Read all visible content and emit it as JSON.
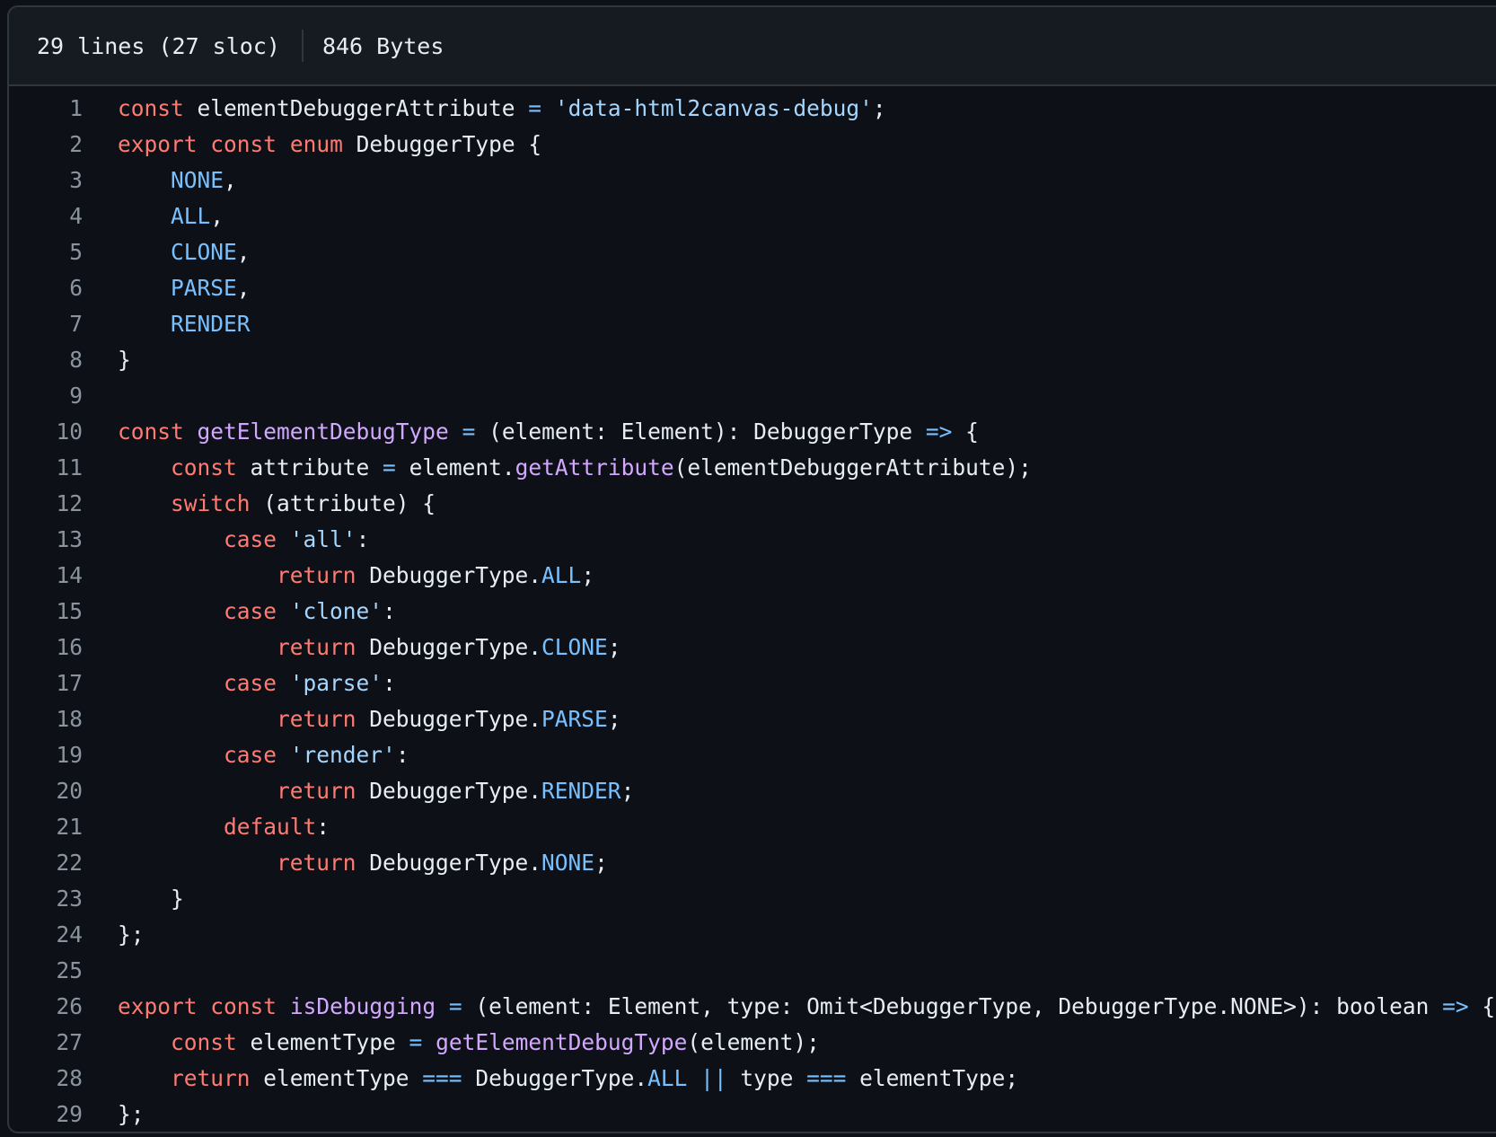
{
  "file_info": {
    "lines": "29 lines (27 sloc)",
    "size": "846 Bytes"
  },
  "colors": {
    "background": "#0d1117",
    "header_background": "#161b22",
    "border": "#30363d",
    "line_number": "#8b949e",
    "text": "#e6edf3",
    "keyword": "#ff7b72",
    "function": "#d2a8ff",
    "constant": "#79c0ff",
    "string": "#a5d6ff"
  },
  "code_lines": [
    {
      "n": "1",
      "tokens": [
        [
          "k",
          "const"
        ],
        [
          "t",
          " elementDebuggerAttribute "
        ],
        [
          "c",
          "="
        ],
        [
          "t",
          " "
        ],
        [
          "s",
          "'data-html2canvas-debug'"
        ],
        [
          "t",
          ";"
        ]
      ]
    },
    {
      "n": "2",
      "tokens": [
        [
          "k",
          "export"
        ],
        [
          "t",
          " "
        ],
        [
          "k",
          "const"
        ],
        [
          "t",
          " "
        ],
        [
          "k",
          "enum"
        ],
        [
          "t",
          " DebuggerType {"
        ]
      ]
    },
    {
      "n": "3",
      "tokens": [
        [
          "t",
          "    "
        ],
        [
          "c",
          "NONE"
        ],
        [
          "t",
          ","
        ]
      ]
    },
    {
      "n": "4",
      "tokens": [
        [
          "t",
          "    "
        ],
        [
          "c",
          "ALL"
        ],
        [
          "t",
          ","
        ]
      ]
    },
    {
      "n": "5",
      "tokens": [
        [
          "t",
          "    "
        ],
        [
          "c",
          "CLONE"
        ],
        [
          "t",
          ","
        ]
      ]
    },
    {
      "n": "6",
      "tokens": [
        [
          "t",
          "    "
        ],
        [
          "c",
          "PARSE"
        ],
        [
          "t",
          ","
        ]
      ]
    },
    {
      "n": "7",
      "tokens": [
        [
          "t",
          "    "
        ],
        [
          "c",
          "RENDER"
        ]
      ]
    },
    {
      "n": "8",
      "tokens": [
        [
          "t",
          "}"
        ]
      ]
    },
    {
      "n": "9",
      "tokens": [
        [
          "t",
          ""
        ]
      ]
    },
    {
      "n": "10",
      "tokens": [
        [
          "k",
          "const"
        ],
        [
          "t",
          " "
        ],
        [
          "f",
          "getElementDebugType"
        ],
        [
          "t",
          " "
        ],
        [
          "c",
          "="
        ],
        [
          "t",
          " (element: Element): DebuggerType "
        ],
        [
          "c",
          "=>"
        ],
        [
          "t",
          " {"
        ]
      ]
    },
    {
      "n": "11",
      "tokens": [
        [
          "t",
          "    "
        ],
        [
          "k",
          "const"
        ],
        [
          "t",
          " attribute "
        ],
        [
          "c",
          "="
        ],
        [
          "t",
          " element."
        ],
        [
          "f",
          "getAttribute"
        ],
        [
          "t",
          "(elementDebuggerAttribute);"
        ]
      ]
    },
    {
      "n": "12",
      "tokens": [
        [
          "t",
          "    "
        ],
        [
          "k",
          "switch"
        ],
        [
          "t",
          " (attribute) {"
        ]
      ]
    },
    {
      "n": "13",
      "tokens": [
        [
          "t",
          "        "
        ],
        [
          "k",
          "case"
        ],
        [
          "t",
          " "
        ],
        [
          "s",
          "'all'"
        ],
        [
          "t",
          ":"
        ]
      ]
    },
    {
      "n": "14",
      "tokens": [
        [
          "t",
          "            "
        ],
        [
          "k",
          "return"
        ],
        [
          "t",
          " DebuggerType."
        ],
        [
          "c",
          "ALL"
        ],
        [
          "t",
          ";"
        ]
      ]
    },
    {
      "n": "15",
      "tokens": [
        [
          "t",
          "        "
        ],
        [
          "k",
          "case"
        ],
        [
          "t",
          " "
        ],
        [
          "s",
          "'clone'"
        ],
        [
          "t",
          ":"
        ]
      ]
    },
    {
      "n": "16",
      "tokens": [
        [
          "t",
          "            "
        ],
        [
          "k",
          "return"
        ],
        [
          "t",
          " DebuggerType."
        ],
        [
          "c",
          "CLONE"
        ],
        [
          "t",
          ";"
        ]
      ]
    },
    {
      "n": "17",
      "tokens": [
        [
          "t",
          "        "
        ],
        [
          "k",
          "case"
        ],
        [
          "t",
          " "
        ],
        [
          "s",
          "'parse'"
        ],
        [
          "t",
          ":"
        ]
      ]
    },
    {
      "n": "18",
      "tokens": [
        [
          "t",
          "            "
        ],
        [
          "k",
          "return"
        ],
        [
          "t",
          " DebuggerType."
        ],
        [
          "c",
          "PARSE"
        ],
        [
          "t",
          ";"
        ]
      ]
    },
    {
      "n": "19",
      "tokens": [
        [
          "t",
          "        "
        ],
        [
          "k",
          "case"
        ],
        [
          "t",
          " "
        ],
        [
          "s",
          "'render'"
        ],
        [
          "t",
          ":"
        ]
      ]
    },
    {
      "n": "20",
      "tokens": [
        [
          "t",
          "            "
        ],
        [
          "k",
          "return"
        ],
        [
          "t",
          " DebuggerType."
        ],
        [
          "c",
          "RENDER"
        ],
        [
          "t",
          ";"
        ]
      ]
    },
    {
      "n": "21",
      "tokens": [
        [
          "t",
          "        "
        ],
        [
          "k",
          "default"
        ],
        [
          "t",
          ":"
        ]
      ]
    },
    {
      "n": "22",
      "tokens": [
        [
          "t",
          "            "
        ],
        [
          "k",
          "return"
        ],
        [
          "t",
          " DebuggerType."
        ],
        [
          "c",
          "NONE"
        ],
        [
          "t",
          ";"
        ]
      ]
    },
    {
      "n": "23",
      "tokens": [
        [
          "t",
          "    }"
        ]
      ]
    },
    {
      "n": "24",
      "tokens": [
        [
          "t",
          "};"
        ]
      ]
    },
    {
      "n": "25",
      "tokens": [
        [
          "t",
          ""
        ]
      ]
    },
    {
      "n": "26",
      "tokens": [
        [
          "k",
          "export"
        ],
        [
          "t",
          " "
        ],
        [
          "k",
          "const"
        ],
        [
          "t",
          " "
        ],
        [
          "f",
          "isDebugging"
        ],
        [
          "t",
          " "
        ],
        [
          "c",
          "="
        ],
        [
          "t",
          " (element: Element, type: Omit<DebuggerType, DebuggerType.NONE>): boolean "
        ],
        [
          "c",
          "=>"
        ],
        [
          "t",
          " {"
        ]
      ]
    },
    {
      "n": "27",
      "tokens": [
        [
          "t",
          "    "
        ],
        [
          "k",
          "const"
        ],
        [
          "t",
          " elementType "
        ],
        [
          "c",
          "="
        ],
        [
          "t",
          " "
        ],
        [
          "f",
          "getElementDebugType"
        ],
        [
          "t",
          "(element);"
        ]
      ]
    },
    {
      "n": "28",
      "tokens": [
        [
          "t",
          "    "
        ],
        [
          "k",
          "return"
        ],
        [
          "t",
          " elementType "
        ],
        [
          "c",
          "==="
        ],
        [
          "t",
          " DebuggerType."
        ],
        [
          "c",
          "ALL"
        ],
        [
          "t",
          " "
        ],
        [
          "c",
          "||"
        ],
        [
          "t",
          " type "
        ],
        [
          "c",
          "==="
        ],
        [
          "t",
          " elementType;"
        ]
      ]
    },
    {
      "n": "29",
      "tokens": [
        [
          "t",
          "};"
        ]
      ]
    }
  ]
}
